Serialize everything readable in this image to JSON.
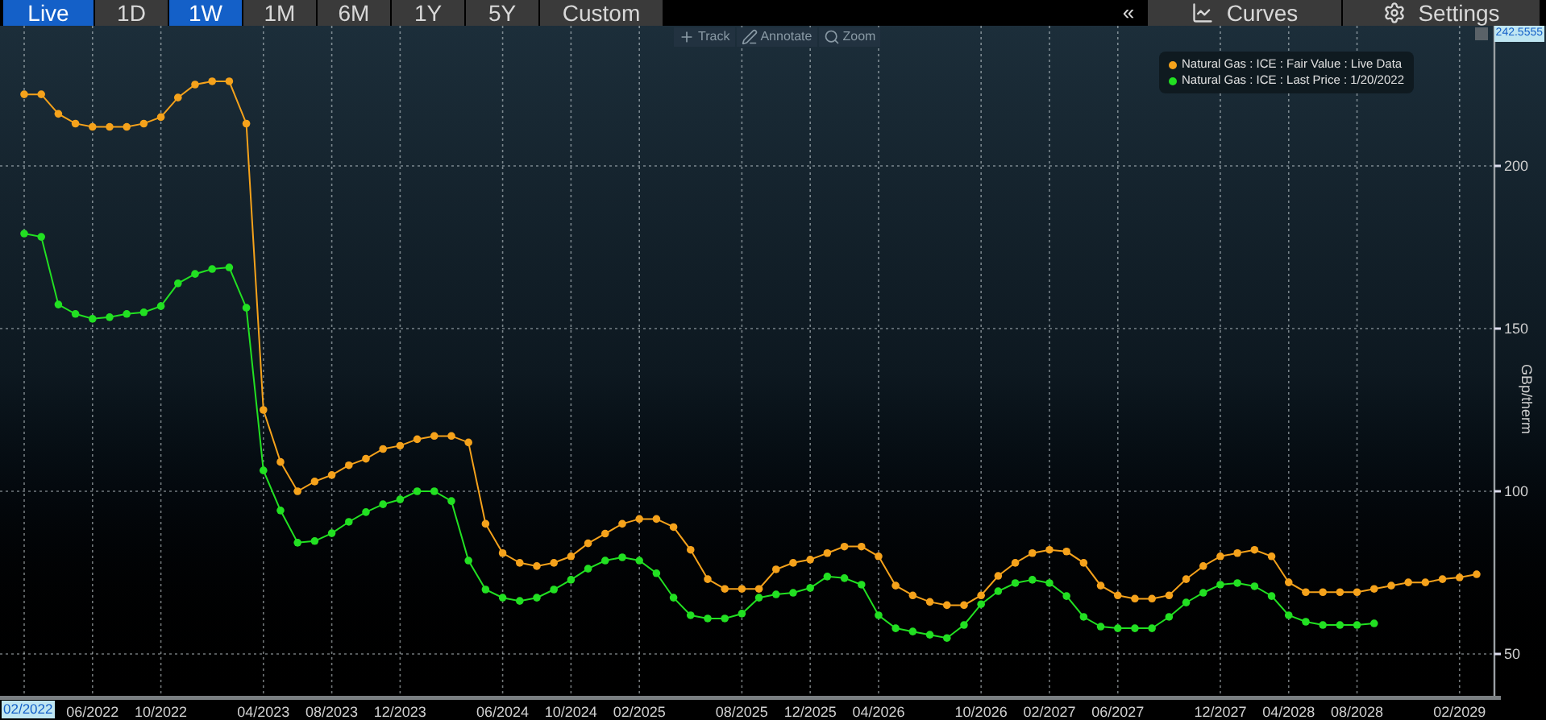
{
  "toolbar": {
    "live": {
      "label": "Live",
      "on": true
    },
    "ranges": [
      {
        "label": "1D",
        "selected": false
      },
      {
        "label": "1W",
        "selected": true
      },
      {
        "label": "1M",
        "selected": false
      },
      {
        "label": "6M",
        "selected": false
      },
      {
        "label": "1Y",
        "selected": false
      },
      {
        "label": "5Y",
        "selected": false
      },
      {
        "label": "Custom",
        "selected": false
      }
    ],
    "collapse": "«",
    "curves": "Curves",
    "settings": "Settings"
  },
  "chart_tools": [
    "Track",
    "Annotate",
    "Zoom"
  ],
  "chart": {
    "top_value": "242.5555",
    "cursor_label": "02/2022",
    "chart_data": {
      "type": "line",
      "grid": true,
      "ylabel": "GBp/therm",
      "categories": [
        null,
        null,
        null,
        null,
        "06/2022",
        null,
        null,
        null,
        "10/2022",
        null,
        null,
        null,
        null,
        null,
        "04/2023",
        null,
        null,
        null,
        "08/2023",
        null,
        null,
        null,
        "12/2023",
        null,
        null,
        null,
        null,
        null,
        "06/2024",
        null,
        null,
        null,
        "10/2024",
        null,
        null,
        null,
        "02/2025",
        null,
        null,
        null,
        null,
        null,
        "08/2025",
        null,
        null,
        null,
        "12/2025",
        null,
        null,
        null,
        "04/2026",
        null,
        null,
        null,
        null,
        null,
        "10/2026",
        null,
        null,
        null,
        "02/2027",
        null,
        null,
        null,
        "06/2027",
        null,
        null,
        null,
        null,
        null,
        "12/2027",
        null,
        null,
        null,
        "04/2028",
        null,
        null,
        null,
        "08/2028",
        null,
        null,
        null,
        null,
        null,
        "02/2029",
        null
      ],
      "series": [
        {
          "name": "Natural Gas : ICE : Fair Value : Live Data",
          "color": "#f5a21b",
          "marker": "circle",
          "values": [
            222,
            222,
            216,
            213,
            212,
            212,
            212,
            213,
            215,
            221,
            225,
            226,
            226,
            213,
            125,
            109,
            100,
            103,
            105,
            108,
            110,
            113,
            114,
            116,
            117,
            117,
            115,
            90,
            81,
            78,
            77,
            78,
            80,
            84,
            87,
            90,
            91.5,
            91.5,
            89,
            82,
            73,
            70,
            70,
            70,
            76,
            78,
            79,
            81,
            83,
            83,
            80,
            71,
            68,
            66,
            65,
            65,
            68,
            74,
            78,
            81,
            82,
            81.5,
            78,
            71,
            68,
            67,
            67,
            68,
            73,
            77,
            80,
            81,
            82,
            80,
            72,
            69,
            69,
            69,
            69,
            70,
            71,
            72,
            72,
            73,
            73.5,
            74.5
          ]
        },
        {
          "name": "Natural Gas : ICE : Last Price : 1/20/2022",
          "color": "#22e022",
          "marker": "circle",
          "values": [
            179.2,
            178.2,
            157.4,
            154.5,
            153,
            153.5,
            154.5,
            155,
            156.9,
            163.9,
            166.8,
            168.3,
            168.8,
            156.4,
            106.4,
            94.1,
            84.2,
            84.7,
            87.1,
            90.6,
            93.6,
            96,
            97.5,
            100,
            100,
            97,
            78.7,
            69.8,
            67.3,
            66.3,
            67.3,
            69.8,
            72.8,
            76.2,
            78.7,
            79.7,
            78.7,
            74.8,
            67.3,
            61.9,
            60.9,
            60.9,
            62.4,
            67.3,
            68.3,
            68.8,
            70.3,
            73.8,
            73.3,
            71.3,
            61.9,
            57.9,
            56.9,
            55.9,
            54.9,
            58.9,
            65.3,
            69.3,
            71.8,
            72.8,
            71.8,
            67.8,
            61.4,
            58.4,
            57.9,
            57.9,
            57.9,
            61.4,
            65.8,
            68.8,
            71.3,
            71.8,
            70.8,
            67.8,
            61.9,
            59.9,
            58.9,
            58.9,
            58.9,
            59.4,
            null,
            null,
            null,
            null,
            null,
            null
          ]
        }
      ],
      "ylim": [
        37.13,
        243.07
      ],
      "yticks": [
        50,
        100,
        150,
        200
      ]
    }
  }
}
